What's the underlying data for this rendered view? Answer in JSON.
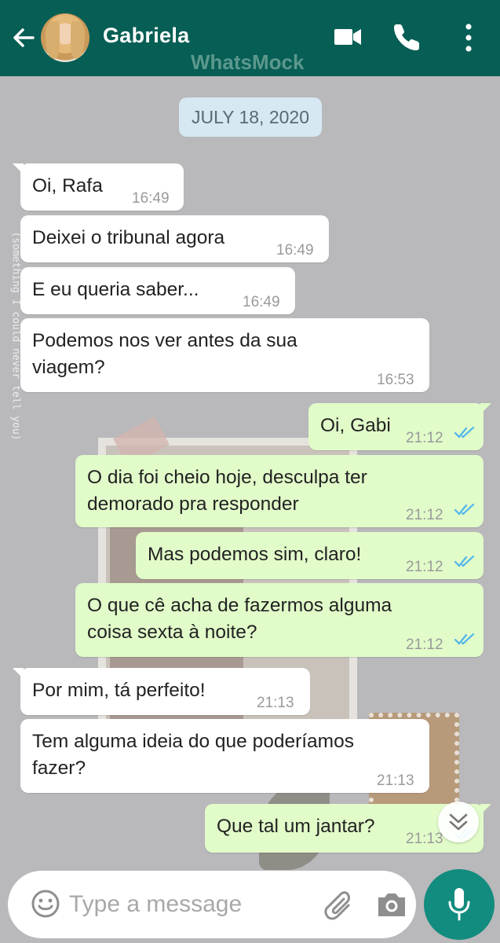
{
  "header": {
    "contact_name": "Gabriela",
    "watermark": "WhatsMock",
    "icons": [
      "back-arrow-icon",
      "video-call-icon",
      "voice-call-icon",
      "more-menu-icon"
    ]
  },
  "wallpaper": {
    "side_text": "(something I could never tell you)"
  },
  "date_chip": "JULY 18, 2020",
  "messages": [
    {
      "dir": "in",
      "text": "Oi, Rafa",
      "time": "16:49"
    },
    {
      "dir": "in",
      "text": "Deixei o tribunal agora",
      "time": "16:49"
    },
    {
      "dir": "in",
      "text": "E eu queria saber...",
      "time": "16:49"
    },
    {
      "dir": "in",
      "line1": "Podemos nos ver antes da sua",
      "line2": "viagem?",
      "time": "16:53"
    },
    {
      "dir": "out",
      "text": "Oi, Gabi",
      "time": "21:12"
    },
    {
      "dir": "out",
      "line1": "O dia foi cheio hoje, desculpa ter",
      "line2": "demorado pra responder",
      "time": "21:12"
    },
    {
      "dir": "out",
      "text": "Mas podemos sim, claro!",
      "time": "21:12"
    },
    {
      "dir": "out",
      "line1": "O que cê acha de fazermos alguma",
      "line2": "coisa sexta à noite?",
      "time": "21:12"
    },
    {
      "dir": "in",
      "text": "Por mim, tá perfeito!",
      "time": "21:13"
    },
    {
      "dir": "in",
      "line1": "Tem alguma ideia do que poderíamos",
      "line2": "fazer?",
      "time": "21:13"
    },
    {
      "dir": "out",
      "text": "Que tal um jantar?",
      "time": "21:13"
    }
  ],
  "input": {
    "placeholder": "Type a message"
  },
  "colors": {
    "header": "#075e54",
    "outgoing_bubble": "#e1fbc9",
    "incoming_bubble": "#ffffff",
    "mic_button": "#128c7e",
    "read_ticks": "#4fb6ec"
  }
}
